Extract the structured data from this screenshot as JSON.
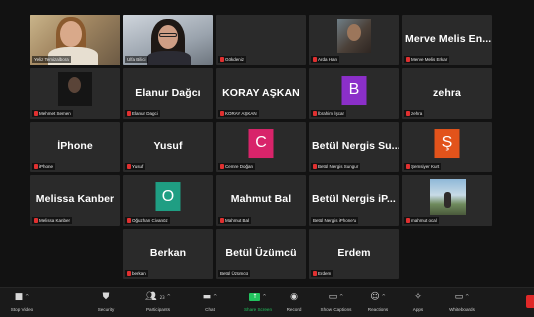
{
  "participants": [
    {
      "name": "Yeliz Temizalbora",
      "display": "",
      "video": "yeliz",
      "active": true,
      "muted": false
    },
    {
      "name": "Ulfa Bilici",
      "display": "",
      "video": "ulfa",
      "muted": false
    },
    {
      "name": "Gökdeniz",
      "display": "",
      "muted": true
    },
    {
      "name": "Arda Han",
      "display": "",
      "video": "arda",
      "muted": true
    },
    {
      "name": "Merve Melis Erkar",
      "display": "Merve Melis En...",
      "muted": true
    },
    {
      "name": "Mehmet Semen",
      "display": "",
      "video": "mehmet",
      "muted": true
    },
    {
      "name": "Elanur Dagci",
      "display": "Elanur Dağcı",
      "muted": true
    },
    {
      "name": "KORAY AŞKAN",
      "display": "KORAY AŞKAN",
      "muted": true
    },
    {
      "name": "İbrahim İşcar",
      "display": "",
      "avatar": "B",
      "avatar_color": "#8b2fc9",
      "muted": true
    },
    {
      "name": "zehra",
      "display": "zehra",
      "muted": true
    },
    {
      "name": "iPhone",
      "display": "İPhone",
      "muted": true
    },
    {
      "name": "Yusuf",
      "display": "Yusuf",
      "muted": true
    },
    {
      "name": "Cemre Doğan",
      "display": "",
      "avatar": "C",
      "avatar_color": "#d8246a",
      "muted": true
    },
    {
      "name": "Betül Nergis Sungur",
      "display": "Betül Nergis Su...",
      "muted": true
    },
    {
      "name": "Şemsiyer Kurt",
      "display": "",
      "avatar": "Ş",
      "avatar_color": "#e2531b",
      "muted": true
    },
    {
      "name": "Melissa Kanber",
      "display": "Melissa Kanber",
      "muted": true
    },
    {
      "name": "Oğuzhan Civanöz",
      "display": "",
      "avatar": "O",
      "avatar_color": "#1f9e83",
      "muted": true
    },
    {
      "name": "Mahmut Bal",
      "display": "Mahmut Bal",
      "muted": true
    },
    {
      "name": "Betül Nergis iPhone'u",
      "display": "Betül Nergis iP...",
      "muted": false
    },
    {
      "name": "mahmut ocal",
      "display": "",
      "video": "mahmut",
      "muted": true
    },
    {
      "empty": true
    },
    {
      "name": "berkan",
      "display": "Berkan",
      "muted": true
    },
    {
      "name": "Betül Üzümcü",
      "display": "Betül Üzümcü",
      "muted": false
    },
    {
      "name": "Erdem",
      "display": "Erdem",
      "muted": true
    },
    {
      "empty": true
    }
  ],
  "toolbar": {
    "stop_video": "Stop Video",
    "security": "Security",
    "participants": "Participants",
    "participants_count": "23",
    "chat": "Chat",
    "share_screen": "Share Screen",
    "record": "Record",
    "show_captions": "Show Captions",
    "reactions": "Reactions",
    "apps": "Apps",
    "whiteboards": "Whiteboards"
  },
  "colors": {
    "background": "#121212",
    "tile": "#2a2a2a",
    "active_speaker": "#e9e27a",
    "muted": "#e03030",
    "share_green": "#22c35e"
  }
}
